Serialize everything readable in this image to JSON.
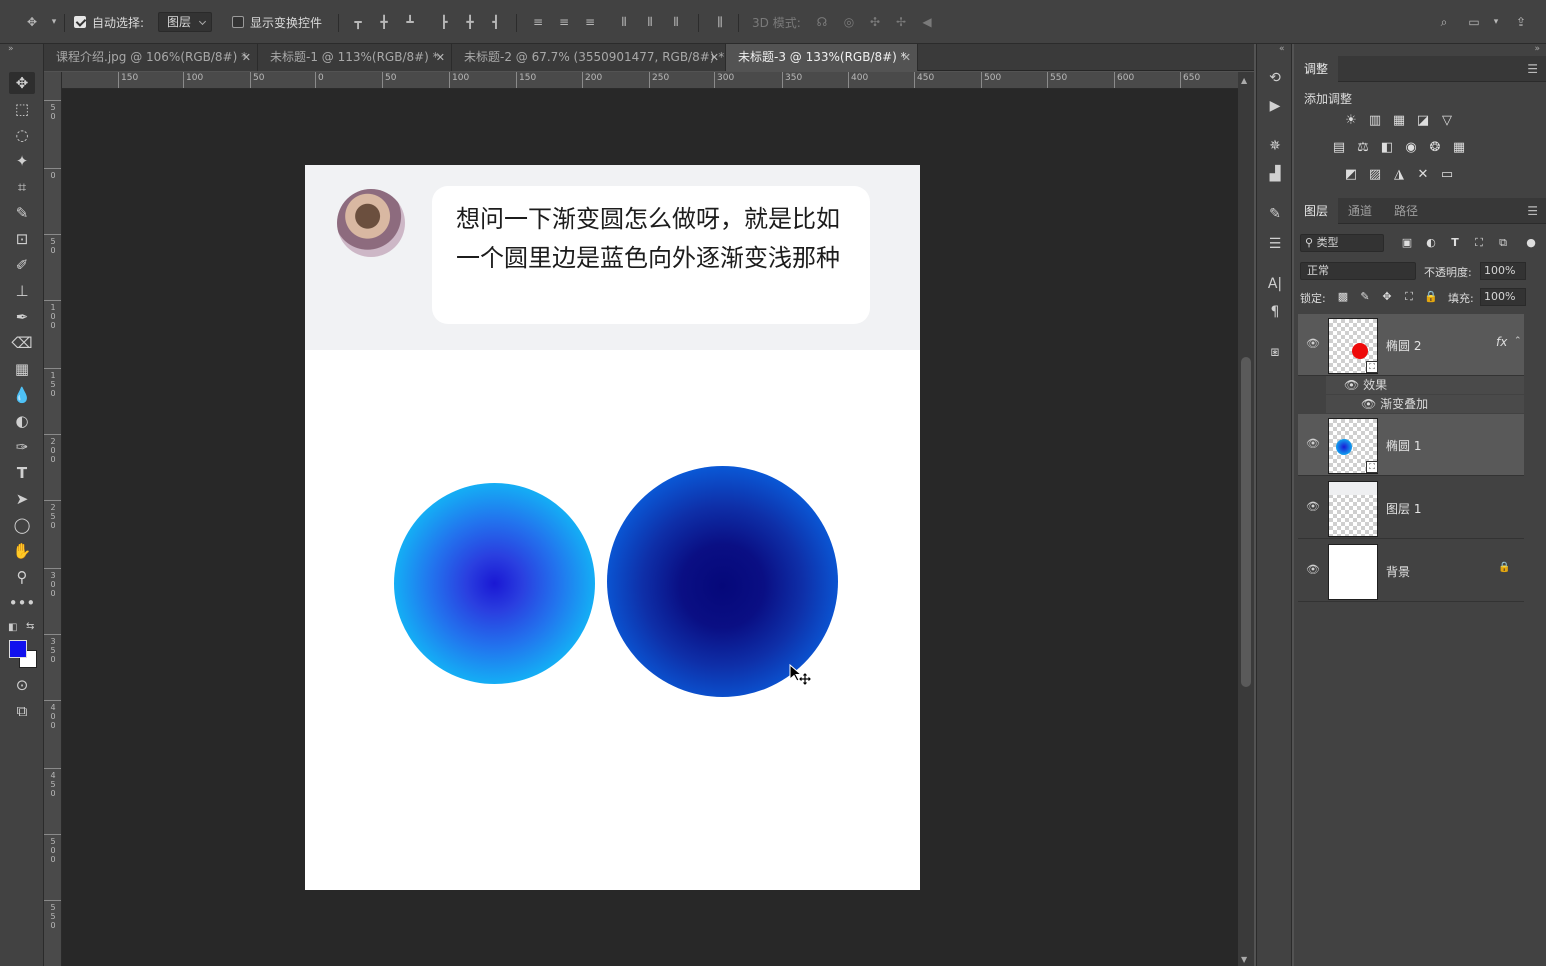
{
  "options_bar": {
    "auto_select_label": "自动选择:",
    "auto_select_checked": true,
    "auto_select_target": "图层",
    "show_transform_label": "显示变换控件",
    "show_transform_checked": false,
    "mode_3d_label": "3D 模式:"
  },
  "tabs": [
    {
      "label": "课程介绍.jpg @ 106%(RGB/8#) *",
      "active": false
    },
    {
      "label": "未标题-1 @ 113%(RGB/8#) *",
      "active": false
    },
    {
      "label": "未标题-2 @ 67.7% (3550901477, RGB/8#) *",
      "active": false
    },
    {
      "label": "未标题-3 @ 133%(RGB/8#) *",
      "active": true
    }
  ],
  "ruler_top": [
    "150",
    "100",
    "50",
    "0",
    "50",
    "100",
    "150",
    "200",
    "250",
    "300",
    "350",
    "400",
    "450",
    "500",
    "550",
    "600",
    "650"
  ],
  "ruler_left": [
    "50",
    "0",
    "50",
    "100",
    "150",
    "200",
    "250",
    "300",
    "350",
    "400",
    "450",
    "500",
    "550"
  ],
  "canvas": {
    "chat_text": "想问一下渐变圆怎么做呀，就是比如一个圆里边是蓝色向外逐渐变浅那种"
  },
  "colors": {
    "foreground": "#1111ee",
    "background": "#ffffff"
  },
  "adjustments_panel": {
    "tab": "调整",
    "add_label": "添加调整"
  },
  "layers_panel": {
    "tabs": [
      "图层",
      "通道",
      "路径"
    ],
    "filter_kind": "类型",
    "blend_mode": "正常",
    "opacity_label": "不透明度:",
    "opacity_value": "100%",
    "lock_label": "锁定:",
    "fill_label": "填充:",
    "fill_value": "100%",
    "layers": [
      {
        "name": "椭圆 2",
        "fx": "fx",
        "selected": true
      },
      {
        "name": "椭圆 1",
        "selected": true
      },
      {
        "name": "图层 1",
        "selected": false
      },
      {
        "name": "背景",
        "selected": false
      }
    ],
    "effects_label": "效果",
    "effect_item": "渐变叠加"
  }
}
